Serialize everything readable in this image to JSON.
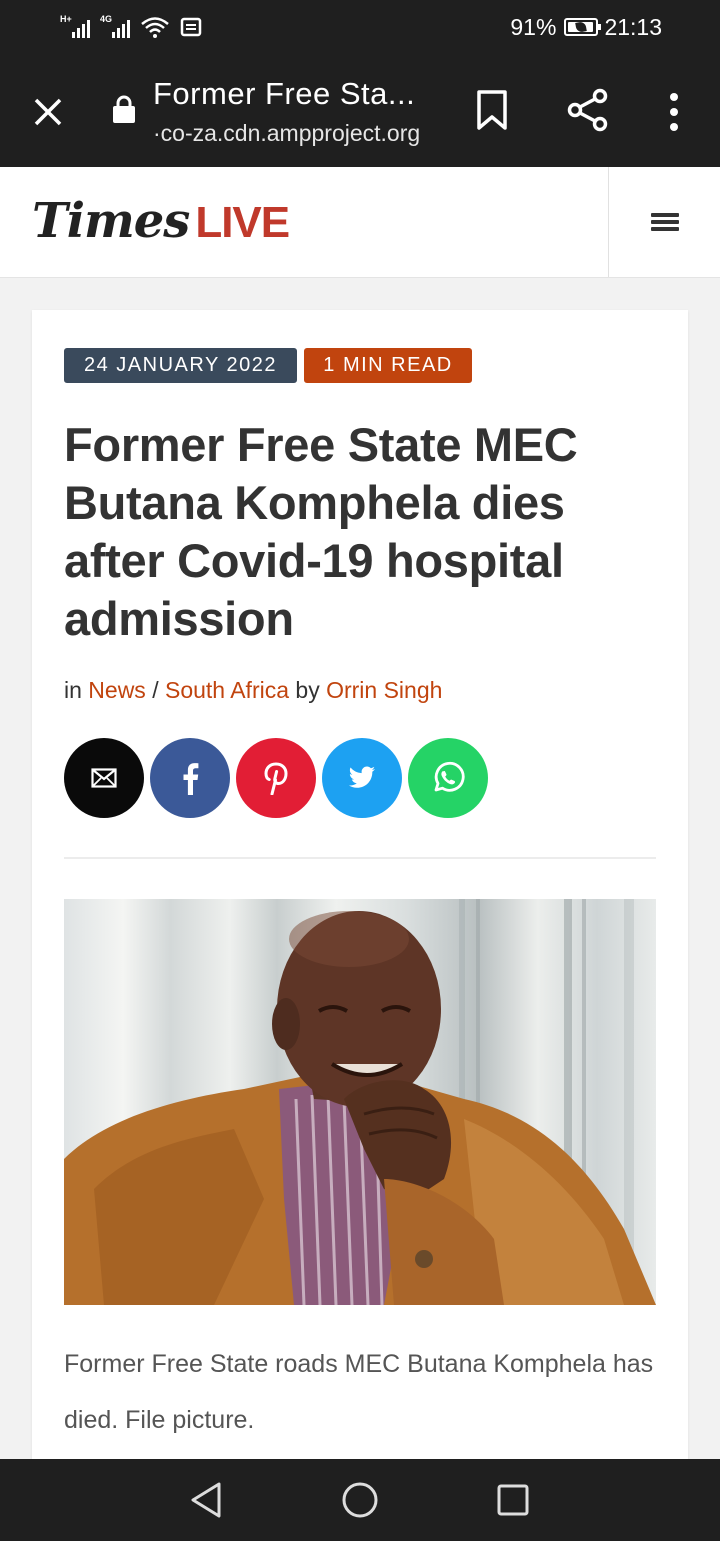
{
  "status_bar": {
    "network_1": "H+",
    "network_2": "4G",
    "battery": "91%",
    "time": "21:13"
  },
  "browser": {
    "title": "Former Free Sta...",
    "url": "·co-za.cdn.ampproject.org"
  },
  "site": {
    "logo_times": "Times",
    "logo_live": "LIVE",
    "brand_color": "#c1440e"
  },
  "article": {
    "date": "24 JANUARY 2022",
    "read_time": "1 MIN READ",
    "headline": "Former Free State MEC Butana Komphela dies after Covid-19 hospital admission",
    "byline": {
      "prefix": "in",
      "section_1": "News",
      "separator": "/",
      "section_2": "South Africa",
      "by": "by",
      "author": "Orrin Singh"
    },
    "caption": "Former Free State roads MEC Butana Komphela has died. File picture."
  },
  "share": [
    {
      "name": "email",
      "icon": "envelope-icon",
      "color": "#0a0a0a"
    },
    {
      "name": "facebook",
      "icon": "facebook-icon",
      "color": "#3b5998"
    },
    {
      "name": "pinterest",
      "icon": "pinterest-icon",
      "color": "#e21e35"
    },
    {
      "name": "twitter",
      "icon": "twitter-icon",
      "color": "#1da1f2"
    },
    {
      "name": "whatsapp",
      "icon": "whatsapp-icon",
      "color": "#25d366"
    }
  ]
}
